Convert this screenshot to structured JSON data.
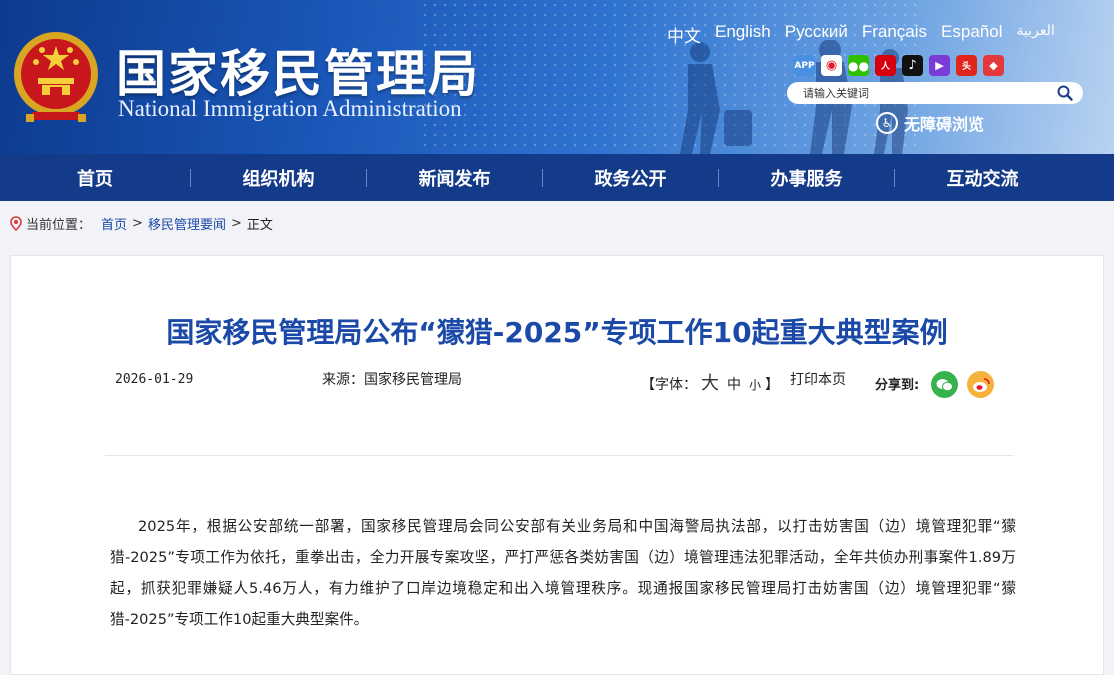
{
  "header": {
    "site_name_cn": "国家移民管理局",
    "site_name_en": "National Immigration Administration",
    "languages": [
      "中文",
      "English",
      "Русский",
      "Français",
      "Español",
      "العربية"
    ],
    "social_icons": [
      "app-icon",
      "weibo-icon",
      "wechat-icon",
      "renmin-icon",
      "douyin-icon",
      "video-icon",
      "toutiao-icon",
      "kuaishou-icon"
    ],
    "search_placeholder": "请输入关键词",
    "accessibility_label": "无障碍浏览",
    "colors": {
      "header_dark": "#0d3a8f",
      "nav_bg": "#143a8a",
      "title_blue": "#1b49a8"
    }
  },
  "nav": {
    "items": [
      "首页",
      "组织机构",
      "新闻发布",
      "政务公开",
      "办事服务",
      "互动交流"
    ]
  },
  "breadcrumb": {
    "label": "当前位置：",
    "items": [
      "首页",
      "移民管理要闻",
      "正文"
    ],
    "separator": ">"
  },
  "article": {
    "title": "国家移民管理局公布“獴猎-2025”专项工作10起重大典型案例",
    "date": "2026-01-29",
    "source": "来源：国家移民管理局",
    "font_label_open": "【字体：",
    "font_big": "大",
    "font_mid": "中",
    "font_small": "小",
    "font_label_close": "】",
    "print_label": "打印本页",
    "share_label": "分享到:",
    "paragraph": "2025年，根据公安部统一部署，国家移民管理局会同公安部有关业务局和中国海警局执法部，以打击妨害国（边）境管理犯罪“獴猎-2025”专项工作为依托，重拳出击，全力开展专案攻坚，严打严惩各类妨害国（边）境管理违法犯罪活动，全年共侦办刑事案件1.89万起，抓获犯罪嫌疑人5.46万人，有力维护了口岸边境稳定和出入境管理秩序。现通报国家移民管理局打击妨害国（边）境管理犯罪“獴猎-2025”专项工作10起重大典型案件。"
  }
}
